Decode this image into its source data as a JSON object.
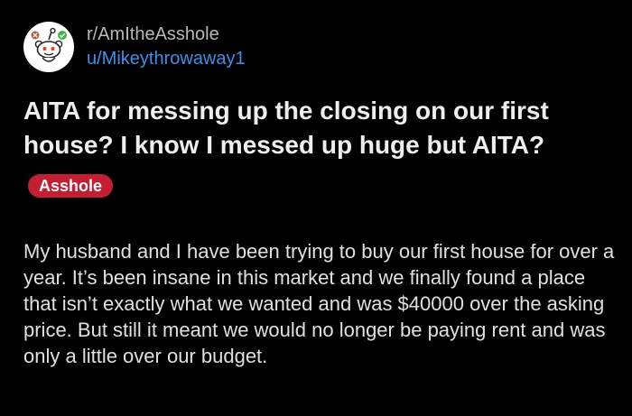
{
  "post": {
    "subreddit": "r/AmItheAsshole",
    "author": "u/Mikeythrowaway1",
    "title": "AITA for messing up the closing on our first house? I know I messed up huge but AITA?",
    "flair": "Asshole",
    "body": "My husband and I have been trying to buy our first house for over a year. It’s been insane in this market and we finally found a place that isn’t exactly what we wanted and was $40000 over the asking price. But still it meant we would no longer be paying rent and was only a little over our budget."
  },
  "icons": {
    "avatar": "reddit-snoo-icon"
  },
  "colors": {
    "background": "#000000",
    "author_link": "#3d8fe8",
    "flair_background": "#c21f33",
    "verified_badge": "#46b14a"
  }
}
